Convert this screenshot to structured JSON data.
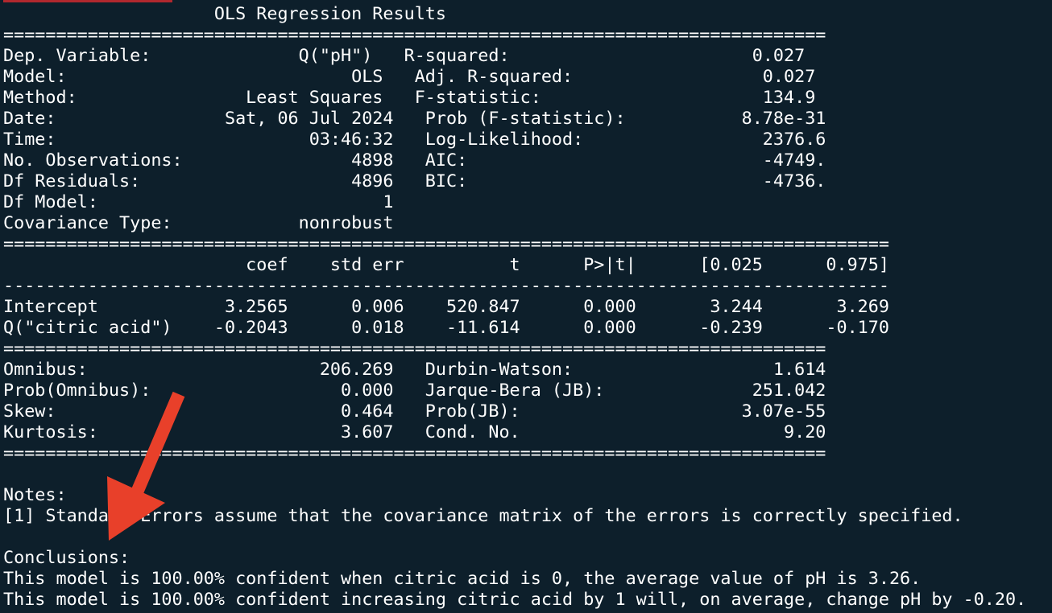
{
  "accent_color": "#b0282e",
  "arrow_color": "#e8402a",
  "terminal": {
    "lines": [
      "                    OLS Regression Results                            ",
      "==============================================================================",
      "Dep. Variable:              Q(\"pH\")   R-squared:                       0.027",
      "Model:                           OLS   Adj. R-squared:                  0.027",
      "Method:                Least Squares   F-statistic:                     134.9",
      "Date:                Sat, 06 Jul 2024   Prob (F-statistic):           8.78e-31",
      "Time:                        03:46:32   Log-Likelihood:                 2376.6",
      "No. Observations:                4898   AIC:                            -4749.",
      "Df Residuals:                    4896   BIC:                            -4736.",
      "Df Model:                           1                                         ",
      "Covariance Type:            nonrobust                                         ",
      "====================================================================================",
      "                       coef    std err          t      P>|t|      [0.025      0.975]",
      "------------------------------------------------------------------------------------",
      "Intercept            3.2565      0.006    520.847      0.000       3.244       3.269",
      "Q(\"citric acid\")    -0.2043      0.018    -11.614      0.000      -0.239      -0.170",
      "==============================================================================",
      "Omnibus:                      206.269   Durbin-Watson:                   1.614",
      "Prob(Omnibus):                  0.000   Jarque-Bera (JB):              251.042",
      "Skew:                           0.464   Prob(JB):                     3.07e-55",
      "Kurtosis:                       3.607   Cond. No.                         9.20",
      "==============================================================================",
      "",
      "Notes:",
      "[1] Standard Errors assume that the covariance matrix of the errors is correctly specified.",
      "",
      "Conclusions:",
      "This model is 100.00% confident when citric acid is 0, the average value of pH is 3.26.",
      "This model is 100.00% confident increasing citric acid by 1 will, on average, change pH by -0.20."
    ]
  }
}
